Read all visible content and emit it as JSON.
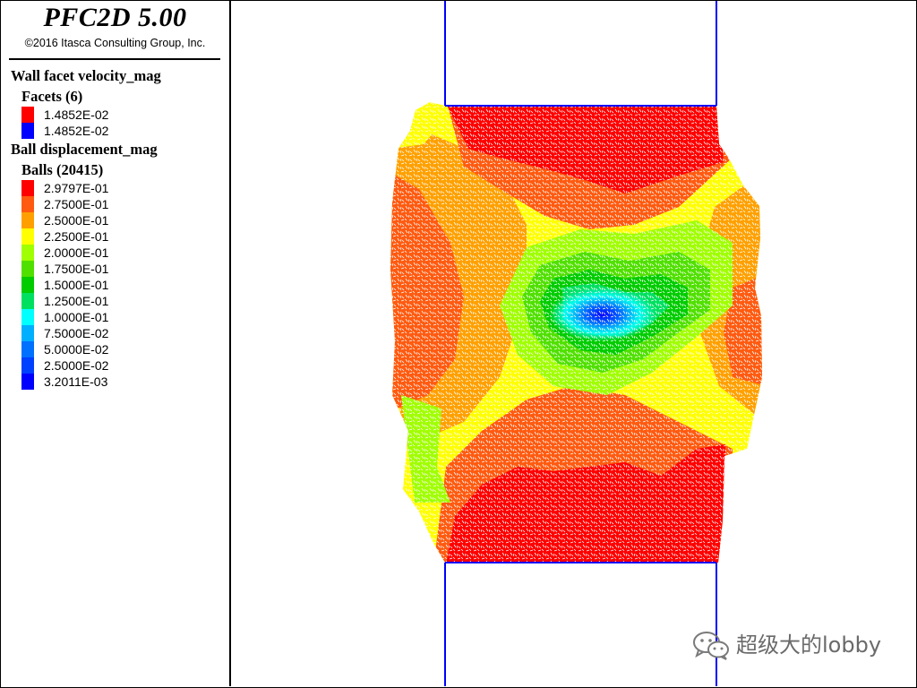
{
  "app": {
    "title": "PFC2D 5.00",
    "copyright": "©2016 Itasca Consulting Group, Inc."
  },
  "legend": {
    "wall_section_title": "Wall facet velocity_mag",
    "facets_title": "Facets (6)",
    "facets": [
      {
        "label": "1.4852E-02",
        "color": "#ff0000"
      },
      {
        "label": "1.4852E-02",
        "color": "#0000ff"
      }
    ],
    "ball_section_title": "Ball displacement_mag",
    "balls_title": "Balls (20415)",
    "balls": [
      {
        "label": "2.9797E-01",
        "color": "#ff0000"
      },
      {
        "label": "2.7500E-01",
        "color": "#ff5a10"
      },
      {
        "label": "2.5000E-01",
        "color": "#ffa000"
      },
      {
        "label": "2.2500E-01",
        "color": "#ffff00"
      },
      {
        "label": "2.0000E-01",
        "color": "#a0ff00"
      },
      {
        "label": "1.7500E-01",
        "color": "#50e000"
      },
      {
        "label": "1.5000E-01",
        "color": "#00cc00"
      },
      {
        "label": "1.2500E-01",
        "color": "#00e060"
      },
      {
        "label": "1.0000E-01",
        "color": "#00ffff"
      },
      {
        "label": "7.5000E-02",
        "color": "#00b0ff"
      },
      {
        "label": "5.0000E-02",
        "color": "#0070ff"
      },
      {
        "label": "2.5000E-02",
        "color": "#0040ff"
      },
      {
        "label": "3.2011E-03",
        "color": "#0000ff"
      }
    ]
  },
  "watermark": {
    "text": "超级大的lobby",
    "icon": "wechat-icon"
  }
}
